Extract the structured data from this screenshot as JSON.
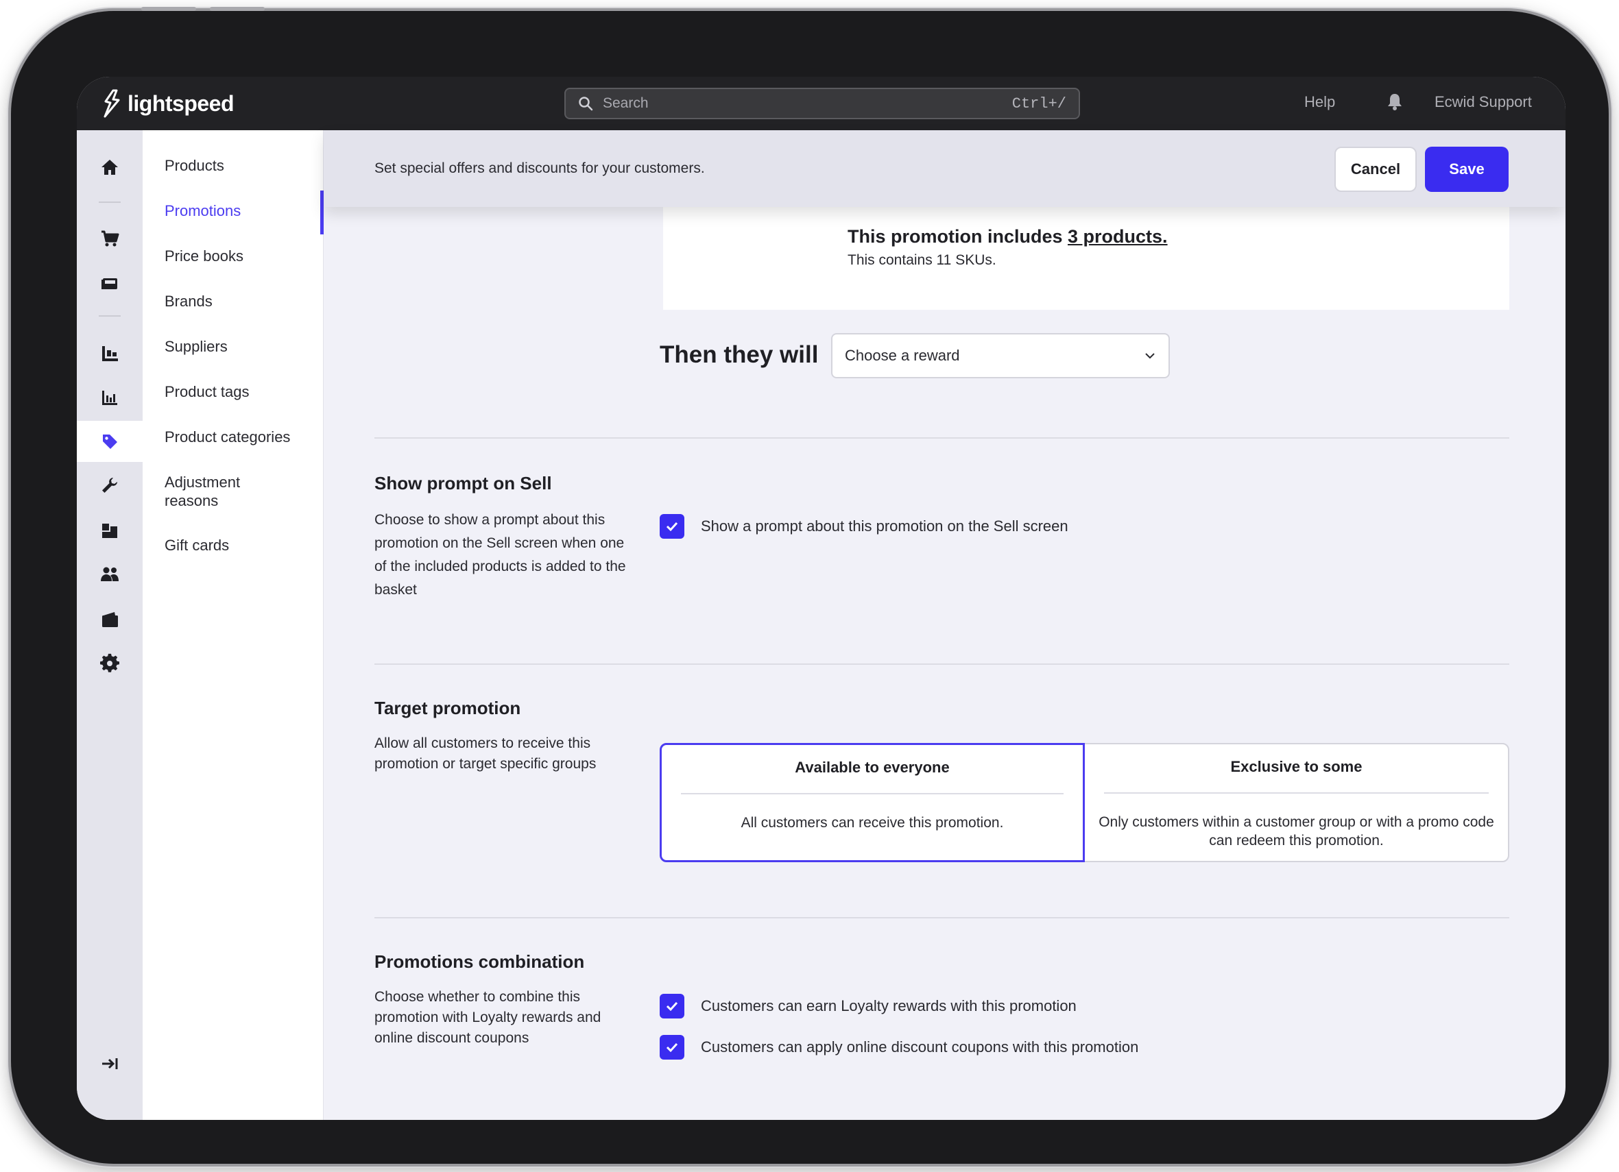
{
  "app": {
    "brand": "lightspeed"
  },
  "topbar": {
    "search_placeholder": "Search",
    "search_shortcut": "Ctrl+/",
    "help": "Help",
    "account": "Ecwid Support"
  },
  "rail": {
    "icons": [
      "home-icon",
      "cart-icon",
      "register-icon",
      "inventory-icon",
      "reports-icon",
      "tag-icon",
      "wrench-icon",
      "boxes-icon",
      "customers-icon",
      "wallet-icon",
      "gear-icon",
      "expand-icon"
    ],
    "active": "tag-icon",
    "accent": "#4b3cf0"
  },
  "subnav": {
    "items": [
      "Products",
      "Promotions",
      "Price books",
      "Brands",
      "Suppliers",
      "Product tags",
      "Product categories",
      "Adjustment reasons",
      "Gift cards"
    ],
    "active": "Promotions"
  },
  "header": {
    "text": "Set special offers and discounts for your customers.",
    "cancel_label": "Cancel",
    "save_label": "Save"
  },
  "promotion_card": {
    "title_prefix": "This promotion includes",
    "title_link": "3 products.",
    "subtitle": "This contains 11 SKUs."
  },
  "reward": {
    "label": "Then they will",
    "select_value": "Choose a reward"
  },
  "show_prompt": {
    "title": "Show prompt on Sell",
    "description": "Choose to show a prompt about this promotion on the Sell screen when one of the included products is added to the basket",
    "checkbox_label": "Show a prompt about this promotion on the Sell screen",
    "checked": true
  },
  "target": {
    "title": "Target promotion",
    "description": "Allow all customers to receive this promotion or target specific groups",
    "options": [
      {
        "title": "Available to everyone",
        "desc": "All customers can receive this promotion.",
        "selected": true
      },
      {
        "title": "Exclusive to some",
        "desc": "Only customers within a customer group or with a promo code can redeem this promotion.",
        "selected": false
      }
    ]
  },
  "combination": {
    "title": "Promotions combination",
    "description": "Choose whether to combine this promotion with Loyalty rewards and online discount coupons",
    "checkboxes": [
      {
        "label": "Customers can earn Loyalty rewards with this promotion",
        "checked": true
      },
      {
        "label": "Customers can apply online discount coupons with this promotion",
        "checked": true
      }
    ]
  },
  "colors": {
    "primary": "#3a2cf0",
    "topbar": "#222225",
    "content_bg": "#f1f1f8"
  }
}
